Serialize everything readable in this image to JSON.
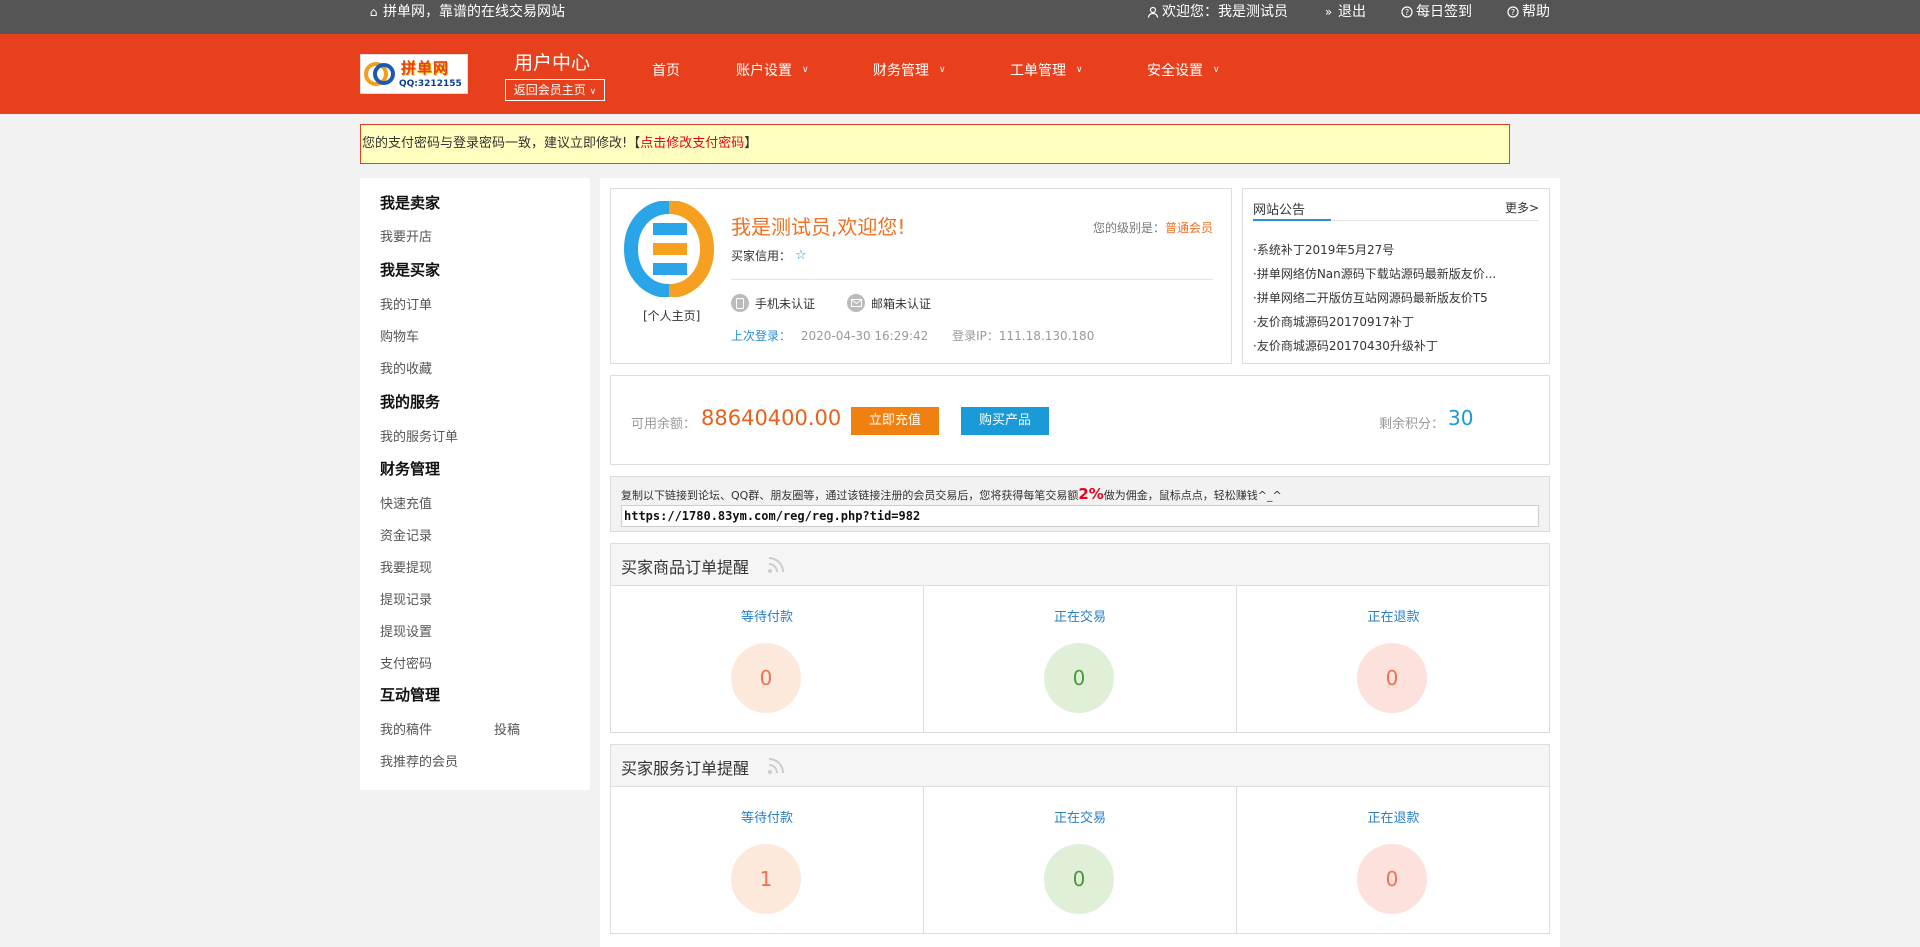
{
  "topbar": {
    "site_slogan": "拼单网，靠谱的在线交易网站",
    "welcome": "欢迎您：我是测试员",
    "logout": "退出",
    "checkin": "每日签到",
    "help": "帮助"
  },
  "header": {
    "logo_brand": "拼单网",
    "logo_qq": "QQ:3212155",
    "user_center": "用户中心",
    "back_button": "返回会员主页",
    "nav": [
      {
        "label": "首页"
      },
      {
        "label": "账户设置"
      },
      {
        "label": "财务管理"
      },
      {
        "label": "工单管理"
      },
      {
        "label": "安全设置"
      }
    ]
  },
  "warning": {
    "text": "您的支付密码与登录密码一致，建议立即修改!【",
    "link": "点击修改支付密码",
    "suffix": "】"
  },
  "sidebar": {
    "sections": [
      {
        "title": "我是卖家",
        "links": [
          "我要开店"
        ]
      },
      {
        "title": "我是买家",
        "links": [
          "我的订单",
          "购物车",
          "我的收藏"
        ]
      },
      {
        "title": "我的服务",
        "links": [
          "我的服务订单"
        ]
      },
      {
        "title": "财务管理",
        "links": [
          "快速充值",
          "资金记录",
          "我要提现",
          "提现记录",
          "提现设置",
          "支付密码"
        ]
      },
      {
        "title": "互动管理",
        "links": [
          "我的稿件",
          "投稿",
          "我推荐的会员"
        ]
      }
    ]
  },
  "profile": {
    "home_link": "[个人主页]",
    "welcome": "我是测试员,欢迎您!",
    "level_label": "您的级别是：",
    "level_value": "普通会员",
    "credit_label": "买家信用：",
    "phone_auth": "手机未认证",
    "email_auth": "邮箱未认证",
    "last_login_label": "上次登录：",
    "last_login_time": "2020-04-30 16:29:42",
    "login_ip": "登录IP：111.18.130.180"
  },
  "notice": {
    "title": "网站公告",
    "more": "更多>",
    "items": [
      "·系统补丁2019年5月27号",
      "·拼单网络仿Nan源码下载站源码最新版友价...",
      "·拼单网络二开版仿互站网源码最新版友价T5",
      "·友价商城源码20170917补丁",
      "·友价商城源码20170430升级补丁"
    ]
  },
  "balance": {
    "label": "可用余额：",
    "amount": "88640400.00",
    "recharge_button": "立即充值",
    "buy_button": "购买产品",
    "points_label": "剩余积分：",
    "points_value": "30"
  },
  "referral": {
    "text_before": "复制以下链接到论坛、QQ群、朋友圈等，通过该链接注册的会员交易后，您将获得每笔交易额",
    "percent": "2%",
    "text_after": "做为佣金，鼠标点点，轻松赚钱^_^",
    "url": "https://1780.83ym.com/reg/reg.php?tid=982"
  },
  "goods_orders": {
    "title": "买家商品订单提醒",
    "columns": [
      {
        "label": "等待付款",
        "count": "0"
      },
      {
        "label": "正在交易",
        "count": "0"
      },
      {
        "label": "正在退款",
        "count": "0"
      }
    ]
  },
  "service_orders": {
    "title": "买家服务订单提醒",
    "columns": [
      {
        "label": "等待付款",
        "count": "1"
      },
      {
        "label": "正在交易",
        "count": "0"
      },
      {
        "label": "正在退款",
        "count": "0"
      }
    ]
  },
  "colors": {
    "header": "#e8401c",
    "topbar": "#555555",
    "accent_orange": "#f07020",
    "accent_blue": "#1a9ad6"
  }
}
